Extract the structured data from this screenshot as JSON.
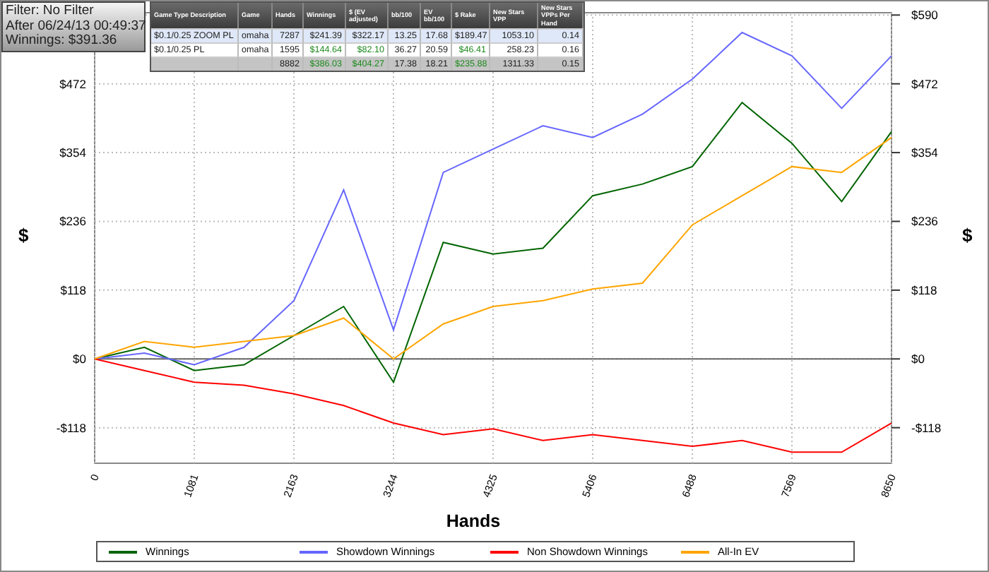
{
  "info_box": {
    "lines": [
      "Filter: No Filter",
      "After 06/24/13 00:49:37",
      "Winnings: $391.36"
    ]
  },
  "table": {
    "columns": [
      "Game Type Description",
      "Game",
      "Hands",
      "Winnings",
      "$ (EV adjusted)",
      "bb/100",
      "EV bb/100",
      "$ Rake",
      "New Stars VPP",
      "New Stars VPPs Per Hand"
    ],
    "rows": [
      {
        "kind": "game",
        "selected": true,
        "cells": [
          {
            "text": "$0.1/0.25 ZOOM PL",
            "gain": false
          },
          {
            "text": "omaha",
            "gain": false
          },
          {
            "text": "7287",
            "gain": false
          },
          {
            "text": "$241.39",
            "gain": false
          },
          {
            "text": "$322.17",
            "gain": false
          },
          {
            "text": "13.25",
            "gain": false
          },
          {
            "text": "17.68",
            "gain": false
          },
          {
            "text": "$189.47",
            "gain": false
          },
          {
            "text": "1053.10",
            "gain": false
          },
          {
            "text": "0.14",
            "gain": false
          }
        ]
      },
      {
        "kind": "game",
        "selected": false,
        "cells": [
          {
            "text": "$0.1/0.25 PL",
            "gain": false
          },
          {
            "text": "omaha",
            "gain": false
          },
          {
            "text": "1595",
            "gain": false
          },
          {
            "text": "$144.64",
            "gain": true
          },
          {
            "text": "$82.10",
            "gain": true
          },
          {
            "text": "36.27",
            "gain": false
          },
          {
            "text": "20.59",
            "gain": false
          },
          {
            "text": "$46.41",
            "gain": true
          },
          {
            "text": "258.23",
            "gain": false
          },
          {
            "text": "0.16",
            "gain": false
          }
        ]
      },
      {
        "kind": "total",
        "cells": [
          {
            "text": ""
          },
          {
            "text": ""
          },
          {
            "text": "8882",
            "gain": false
          },
          {
            "text": "$386.03",
            "gain": true
          },
          {
            "text": "$404.27",
            "gain": true
          },
          {
            "text": "17.38",
            "gain": false
          },
          {
            "text": "18.21",
            "gain": false
          },
          {
            "text": "$235.88",
            "gain": true
          },
          {
            "text": "1311.33",
            "gain": false
          },
          {
            "text": "0.15",
            "gain": false
          }
        ]
      }
    ]
  },
  "chart": {
    "right_axis_label": "$",
    "chart_data": {
      "type": "line",
      "xlabel": "Hands",
      "ylabel": "$",
      "grid": true,
      "x": [
        0,
        540,
        1081,
        1622,
        2163,
        2703,
        3244,
        3784,
        4325,
        4866,
        5406,
        5947,
        6488,
        7028,
        7569,
        8109,
        8650
      ],
      "xlim": [
        0,
        8650
      ],
      "ylim": [
        -179,
        594
      ],
      "xticks": [
        0,
        1081,
        2163,
        3244,
        4325,
        5406,
        6488,
        7569,
        8650
      ],
      "yticks": [
        {
          "value": 590,
          "label": "$590"
        },
        {
          "value": 472,
          "label": "$472"
        },
        {
          "value": 354,
          "label": "$354"
        },
        {
          "value": 236,
          "label": "$236"
        },
        {
          "value": 118,
          "label": "$118"
        },
        {
          "value": 0,
          "label": "$0"
        },
        {
          "value": -118,
          "label": "-$118"
        }
      ],
      "series": [
        {
          "name": "Winnings",
          "color": "#006400",
          "values": [
            0,
            20,
            -20,
            -10,
            40,
            90,
            -40,
            200,
            180,
            190,
            280,
            300,
            330,
            440,
            370,
            270,
            390
          ]
        },
        {
          "name": "Showdown Winnings",
          "color": "#6666ff",
          "values": [
            0,
            10,
            -10,
            20,
            100,
            290,
            50,
            320,
            360,
            400,
            380,
            420,
            480,
            560,
            520,
            430,
            520
          ]
        },
        {
          "name": "Non Showdown Winnings",
          "color": "#ff0000",
          "values": [
            0,
            -20,
            -40,
            -45,
            -60,
            -80,
            -110,
            -130,
            -120,
            -140,
            -130,
            -140,
            -150,
            -140,
            -160,
            -160,
            -110
          ]
        },
        {
          "name": "All-In EV",
          "color": "#ffa500",
          "values": [
            0,
            30,
            20,
            30,
            40,
            70,
            0,
            60,
            90,
            100,
            120,
            130,
            230,
            280,
            330,
            320,
            380
          ]
        }
      ]
    }
  }
}
